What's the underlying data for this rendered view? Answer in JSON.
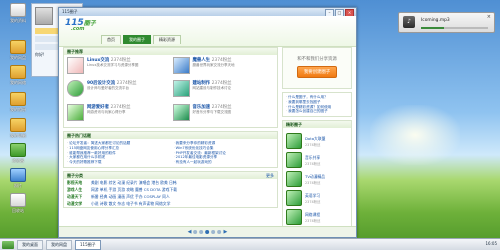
{
  "desktop": {
    "icons": [
      {
        "label": "我的资料"
      },
      {
        "label": "我的网盘"
      },
      {
        "label": "我的网络"
      },
      {
        "label": "我的相册"
      },
      {
        "label": "我的电脑"
      },
      {
        "label": "浏览器"
      },
      {
        "label": "照片"
      },
      {
        "label": "回收站"
      }
    ],
    "greeting": "你好!"
  },
  "window": {
    "title": "115圈子",
    "controls": {
      "minimize": "–",
      "maximize": "□",
      "close": "×"
    }
  },
  "header": {
    "logo_main": "115",
    "logo_suffix": "圈子",
    "logo_domain": ".com",
    "tabs": [
      {
        "label": "首页",
        "active": true
      },
      {
        "label": "我的圈子",
        "active": false
      },
      {
        "label": "精彩资源",
        "active": false
      }
    ]
  },
  "featured": {
    "heading": "圈子推荐",
    "items": [
      {
        "title": "Linux交流",
        "meta": "2374粉丝",
        "desc": "Linux技术交流学习与资源分享圈"
      },
      {
        "title": "魔兽人生",
        "meta": "2374粉丝",
        "desc": "魔兽世界玩家交流分享天地"
      },
      {
        "title": "90后设计交流",
        "meta": "2374粉丝",
        "desc": "设计师与爱好者的交流平台"
      },
      {
        "title": "建站制作",
        "meta": "2374粉丝",
        "desc": "网站建设与制作技术讨论"
      },
      {
        "title": "网游爱好者",
        "meta": "2374粉丝",
        "desc": "网游资讯与玩家心得分享"
      },
      {
        "title": "音乐加速",
        "meta": "2374粉丝",
        "desc": "好音乐分享与下载交流圈"
      }
    ]
  },
  "hot_topics": {
    "heading": "圈子热门话题",
    "left": [
      "论坛开发者：简述大家都在讨论的话题",
      "115网盘网友使用心得分享汇总",
      "谁能帮我推荐一款好用的软件",
      "大家都在用什么手机呢",
      "今天的好歌推荐下载"
    ],
    "right": [
      "我要来分享你的精彩资源",
      "Win7系统优化技巧合集",
      "PHP开发者交流：最新框架讨论",
      "2012年最佳电影资源分享",
      "有没有人一起玩游戏的"
    ]
  },
  "categories": {
    "heading": "圈子分类",
    "more": "更多",
    "rows": [
      {
        "name": "影视天地",
        "items": "美剧 电影 综艺 动漫 纪录片 演唱会 港台 欧美 日韩"
      },
      {
        "name": "游戏人生",
        "items": "网游 单机 手游 页游 攻略 魔兽 CS DOTA 游戏下载"
      },
      {
        "name": "动漫天下",
        "items": "新番 经典 动画 漫画 声优 手办 COSPLAY 同人"
      },
      {
        "name": "动漫文学",
        "items": "小说 诗歌 散文 杂志 电子书 有声读物 网络文学"
      }
    ]
  },
  "sidebar": {
    "promo_question": "和不和我们分享资源",
    "promo_button": "我要创建圈子",
    "qa": [
      "什么是圈子，有什么用？",
      "我要到哪里去找圈子",
      "什么是精彩资源？如何使用",
      "我要怎么创建自己的圈子"
    ],
    "groups_heading": "精彩圈子",
    "groups": [
      {
        "name": "Dota大联盟",
        "meta": "2374粉丝"
      },
      {
        "name": "音乐共享",
        "meta": "2374粉丝"
      },
      {
        "name": "TV动漫精品",
        "meta": "2374粉丝"
      },
      {
        "name": "英语学习",
        "meta": "2374粉丝"
      },
      {
        "name": "网络课程",
        "meta": "2374粉丝"
      }
    ]
  },
  "pager": {
    "prev": "◀",
    "next": "▶",
    "count": 5,
    "active": 2
  },
  "player": {
    "track": "Icoming.mp3",
    "close": "×",
    "progress": 0.35
  },
  "taskbar": {
    "tasks": [
      {
        "label": "我的桌面"
      },
      {
        "label": "我的网盘"
      },
      {
        "label": "115圈子"
      }
    ],
    "tray": "16:05"
  }
}
